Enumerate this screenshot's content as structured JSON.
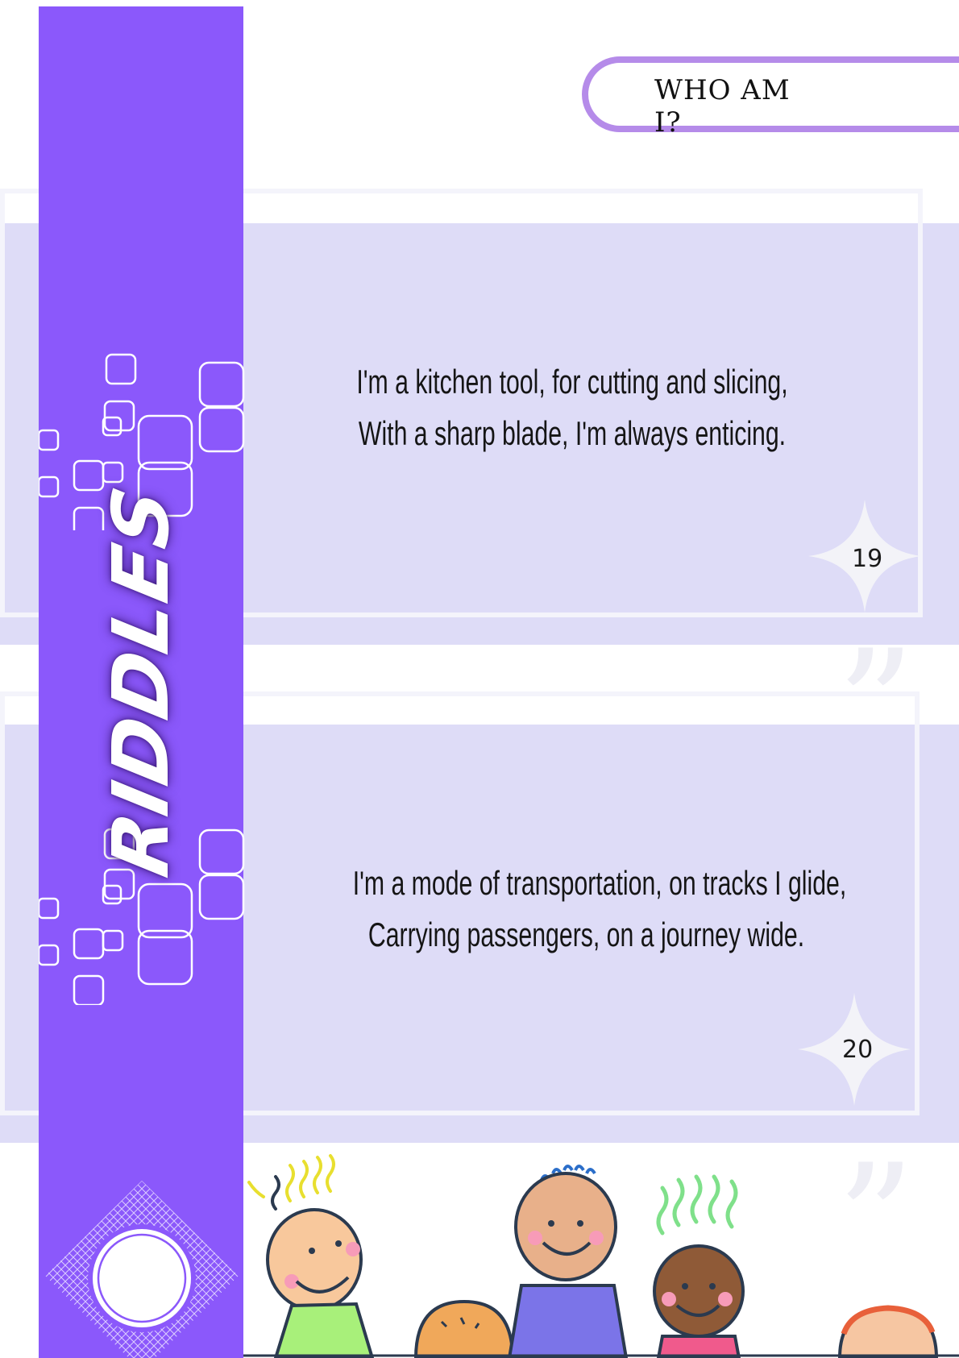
{
  "header": {
    "title": "WHO AM I?"
  },
  "sidebar": {
    "title": "RIDDLES"
  },
  "riddles": [
    {
      "number": "19",
      "lines": [
        "I'm a kitchen tool, for cutting and slicing,",
        "With a sharp blade, I'm always enticing."
      ]
    },
    {
      "number": "20",
      "lines": [
        "I'm a mode of transportation, on tracks I glide,",
        "Carrying passengers, on a journey wide."
      ]
    }
  ],
  "colors": {
    "band": "#8b58fb",
    "card": "#dedcf7",
    "pill_border": "#b58be9",
    "star": "#f3f3f8"
  },
  "icons": [
    "sparkle-star-icon",
    "quote-mark-icon",
    "rounded-squares-decoration",
    "circle-badge-icon",
    "kids-illustration"
  ]
}
